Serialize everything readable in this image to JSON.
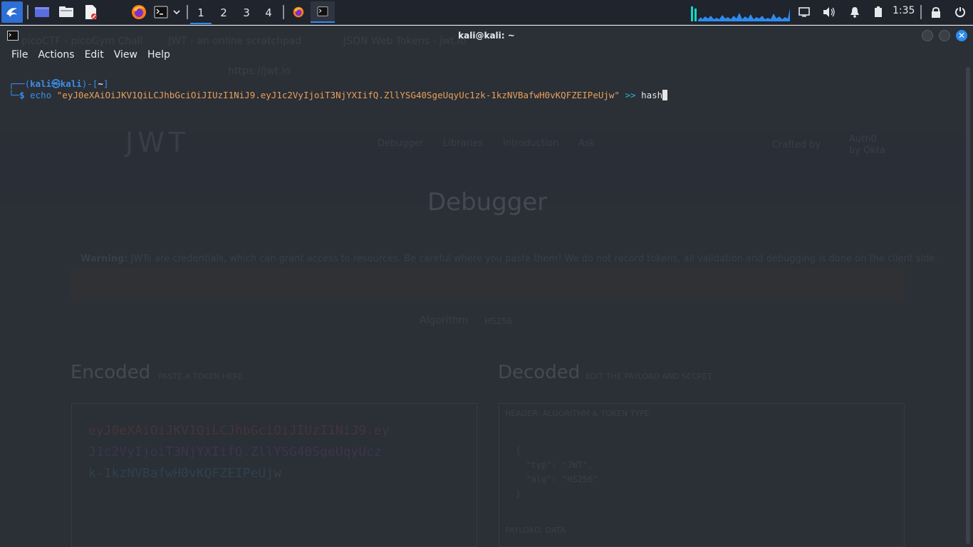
{
  "taskbar": {
    "workspaces": [
      "1",
      "2",
      "3",
      "4"
    ],
    "clock": "1:35",
    "icons": {
      "menu": "kali-dragon-icon",
      "files": "folder-icon",
      "browser": "firefox-icon",
      "terminal": "terminal-icon"
    }
  },
  "window": {
    "title": "kali@kali: ~",
    "menu": [
      "File",
      "Actions",
      "Edit",
      "View",
      "Help"
    ]
  },
  "terminal": {
    "prompt_user": "kali",
    "prompt_at": "㉿",
    "prompt_host": "kali",
    "prompt_dir": "~",
    "command": "echo",
    "argument": "\"eyJ0eXAiOiJKV1QiLCJhbGciOiJIUzI1NiJ9.eyJ1c2VyIjoiT3NjYXIifQ.ZllYSG40SgeUqyUc1zk-1kzNVBafwH0vKQFZEIPeUjw\"",
    "redirect": ">>",
    "target": "hash"
  },
  "background_page": {
    "tabs": [
      "picoCTF - picoGym Chall",
      "JWT - an online scratchpad",
      "JSON Web Tokens - jwt.io"
    ],
    "url": "https://jwt.io",
    "logo_text": "JWT",
    "nav": [
      "Debugger",
      "Libraries",
      "Introduction",
      "Ask"
    ],
    "crafted_by": "Crafted by",
    "auth0": "Auth0",
    "by_okta": "by Okta",
    "heading": "Debugger",
    "warning_bold": "Warning:",
    "warning_text": " JWTs are credentials, which can grant access to resources. Be careful where you paste them! We do not record tokens, all validation and debugging is done on the client side.",
    "algorithm_label": "Algorithm",
    "algorithm_value": "HS256",
    "encoded_title": "Encoded",
    "encoded_hint": "PASTE A TOKEN HERE",
    "decoded_title": "Decoded",
    "decoded_hint": "EDIT THE PAYLOAD AND SECRET",
    "token_lines": [
      "eyJ0eXAiOiJKV1QiLCJhbGciOiJIUzI1NiJ9.ey",
      "J1c2VyIjoiT3NjYXIifQ.ZllYSG40SgeUqyUcz",
      "k-1kzNVBafwH0vKQFZEIPeUjw"
    ],
    "header_label": "HEADER:",
    "header_hint": "ALGORITHM & TOKEN TYPE",
    "json_lines": [
      "{",
      "  \"typ\": \"JWT\",",
      "  \"alg\": \"HS256\"",
      "}"
    ],
    "payload_label": "PAYLOAD:",
    "payload_hint": "DATA"
  }
}
